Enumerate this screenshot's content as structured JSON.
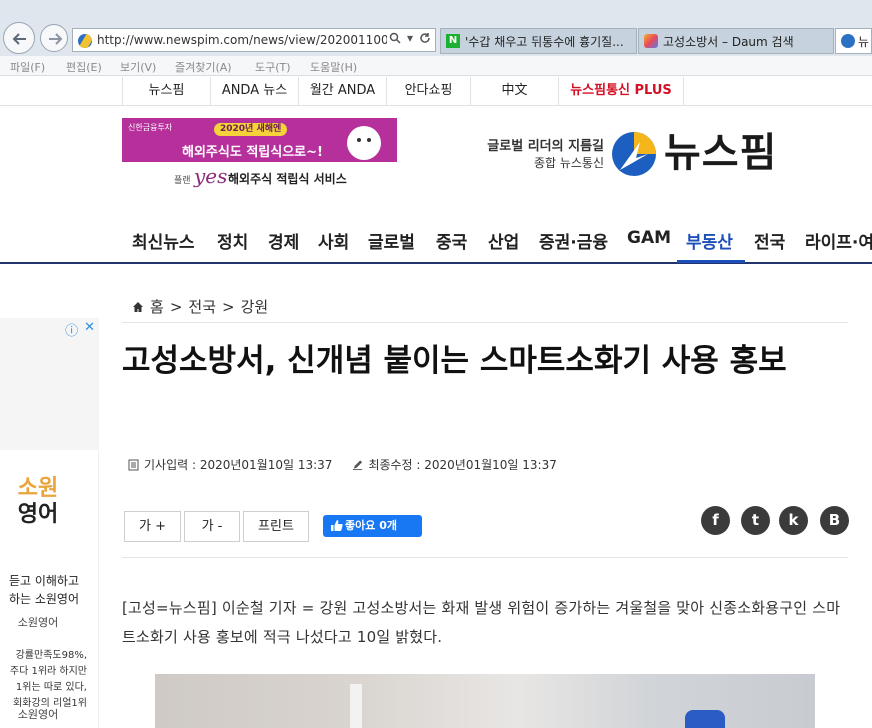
{
  "browser": {
    "address_url": "http://www.newspim.com/news/view/20200110000",
    "tabs": [
      {
        "label": "'수갑 채우고 뒤통수에 흉기질...",
        "favicon": "N"
      },
      {
        "label": "고성소방서 – Daum 검색",
        "favicon": "D"
      },
      {
        "label": "뉴",
        "favicon": ""
      }
    ],
    "menu": [
      "파일(F)",
      "편집(E)",
      "보기(V)",
      "즐겨찾기(A)",
      "도구(T)",
      "도움말(H)"
    ]
  },
  "top_strip": [
    "뉴스핌",
    "ANDA 뉴스",
    "월간 ANDA",
    "안다쇼핑",
    "中文",
    "뉴스핌통신 PLUS"
  ],
  "ad": {
    "sponsor": "신한금융투자",
    "badge": "2020년 새해엔",
    "headline": "해외주식도 적립식으로~!",
    "sub_prefix": "플랜",
    "sub_brand": "yes",
    "sub_text": "해외주식 적립식 서비스"
  },
  "header": {
    "slogan_line1": "글로벌 리더의 지름길",
    "slogan_line2": "종합 뉴스통신",
    "logo_text": "뉴스핌"
  },
  "categories": [
    "최신뉴스",
    "정치",
    "경제",
    "사회",
    "글로벌",
    "중국",
    "산업",
    "증권·금융",
    "GAM",
    "부동산",
    "전국",
    "라이프·여"
  ],
  "active_category": "부동산",
  "side_ad": {
    "brand_line1": "소원",
    "brand_line2": "영어",
    "line1": "듣고 이해하고",
    "line2": "하는 소원영어",
    "source": "소원영어",
    "desc": [
      "강률만족도98%,",
      "주다 1위라 하지만",
      "1위는 따로 있다,",
      "회화강의 리얼1위"
    ],
    "source2": "소원영어"
  },
  "article": {
    "breadcrumb": [
      "홈",
      "전국",
      "강원"
    ],
    "headline": "고성소방서, 신개념 붙이는 스마트소화기 사용 홍보",
    "published_label": "기사입력 : 2020년01월10일 13:37",
    "modified_label": "최종수정 : 2020년01월10일 13:37",
    "buttons": {
      "font_up": "가 +",
      "font_down": "가 -",
      "print": "프린트"
    },
    "fb_like": "좋아요 0개",
    "share": [
      "f",
      "t",
      "k",
      "B"
    ],
    "body": "[고성=뉴스핌] 이순철 기자 = 강원 고성소방서는 화재 발생 위험이 증가하는 겨울철을 맞아 신종소화용구인 스마트소화기 사용 홍보에 적극 나섰다고 10일 밝혔다."
  }
}
